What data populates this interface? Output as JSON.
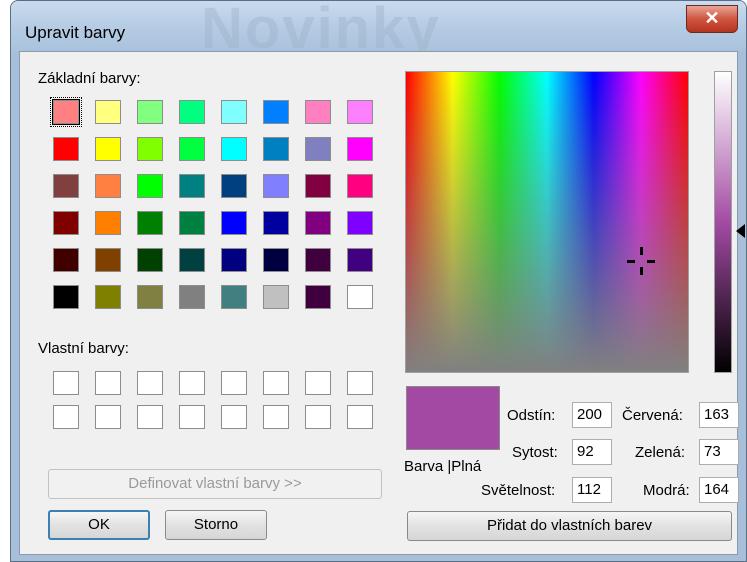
{
  "window": {
    "title": "Upravit barvy",
    "ghost_text": "Novinky"
  },
  "basic_colors": {
    "label": "Základní barvy:",
    "selected_index": 0,
    "rows": [
      [
        "#ff8080",
        "#ffff80",
        "#80ff80",
        "#00ff80",
        "#80ffff",
        "#0080ff",
        "#ff80c0",
        "#ff80ff"
      ],
      [
        "#ff0000",
        "#ffff00",
        "#80ff00",
        "#00ff40",
        "#00ffff",
        "#0080c0",
        "#8080c0",
        "#ff00ff"
      ],
      [
        "#804040",
        "#ff8040",
        "#00ff00",
        "#008080",
        "#004080",
        "#8080ff",
        "#800040",
        "#ff0080"
      ],
      [
        "#800000",
        "#ff8000",
        "#008000",
        "#008040",
        "#0000ff",
        "#0000a0",
        "#800080",
        "#8000ff"
      ],
      [
        "#400000",
        "#804000",
        "#004000",
        "#004040",
        "#000080",
        "#000040",
        "#400040",
        "#400080"
      ],
      [
        "#000000",
        "#808000",
        "#808040",
        "#808080",
        "#408080",
        "#c0c0c0",
        "#400040",
        "#ffffff"
      ]
    ]
  },
  "custom_colors": {
    "label": "Vlastní barvy:",
    "count": 16
  },
  "buttons": {
    "define": "Definovat vlastní barvy >>",
    "ok": "OK",
    "cancel": "Storno",
    "add": "Přidat do vlastních barev"
  },
  "preview": {
    "label": "Barva |Plná",
    "color": "#a349a4"
  },
  "fields": {
    "hue": {
      "label": "Odstín:",
      "value": "200"
    },
    "sat": {
      "label": "Sytost:",
      "value": "92"
    },
    "lum": {
      "label": "Světelnost:",
      "value": "112"
    },
    "red": {
      "label": "Červená:",
      "value": "163"
    },
    "green": {
      "label": "Zelená:",
      "value": "73"
    },
    "blue": {
      "label": "Modrá:",
      "value": "164"
    }
  },
  "icons": {
    "close": "close-icon",
    "crosshair": "crosshair-icon",
    "lum_arrow": "arrow-left-icon"
  }
}
